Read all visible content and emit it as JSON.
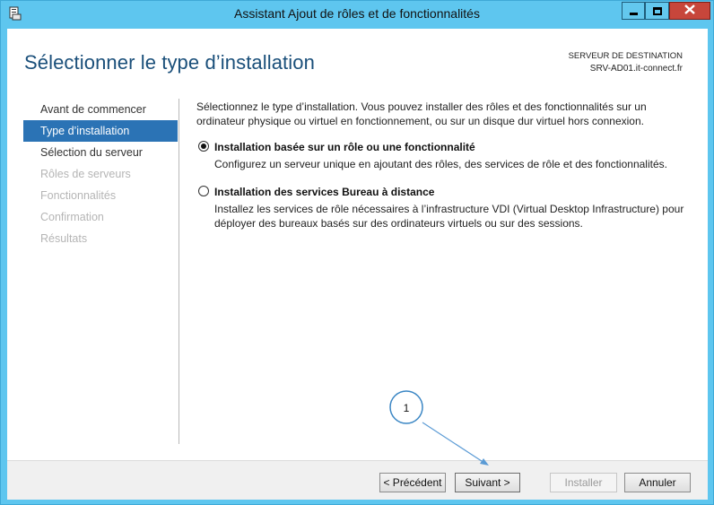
{
  "window": {
    "title": "Assistant Ajout de rôles et de fonctionnalités",
    "controls": {
      "minimize": "▁",
      "maximize": "□",
      "close": "✕"
    }
  },
  "header": {
    "page_title": "Sélectionner le type d’installation",
    "destination_label": "SERVEUR DE DESTINATION",
    "destination_server": "SRV-AD01.it-connect.fr"
  },
  "nav": {
    "items": [
      {
        "label": "Avant de commencer",
        "state": "normal"
      },
      {
        "label": "Type d’installation",
        "state": "active"
      },
      {
        "label": "Sélection du serveur",
        "state": "normal"
      },
      {
        "label": "Rôles de serveurs",
        "state": "disabled"
      },
      {
        "label": "Fonctionnalités",
        "state": "disabled"
      },
      {
        "label": "Confirmation",
        "state": "disabled"
      },
      {
        "label": "Résultats",
        "state": "disabled"
      }
    ]
  },
  "content": {
    "intro": "Sélectionnez le type d’installation. Vous pouvez installer des rôles et des fonctionnalités sur un ordinateur physique ou virtuel en fonctionnement, ou sur un disque dur virtuel hors connexion.",
    "options": [
      {
        "title": "Installation basée sur un rôle ou une fonctionnalité",
        "description": "Configurez un serveur unique en ajoutant des rôles, des services de rôle et des fonctionnalités.",
        "selected": true
      },
      {
        "title": "Installation des services Bureau à distance",
        "description": "Installez les services de rôle nécessaires à l’infrastructure VDI (Virtual Desktop Infrastructure) pour déployer des bureaux basés sur des ordinateurs virtuels ou sur des sessions.",
        "selected": false
      }
    ]
  },
  "footer": {
    "prev_label": "< Précédent",
    "next_label": "Suivant >",
    "install_label": "Installer",
    "cancel_label": "Annuler"
  },
  "annotation": {
    "number": "1"
  },
  "colors": {
    "title_blue": "#1a4f7a",
    "nav_active": "#2b73b5",
    "frame": "#5ec6ef",
    "close_red": "#c7463b"
  }
}
